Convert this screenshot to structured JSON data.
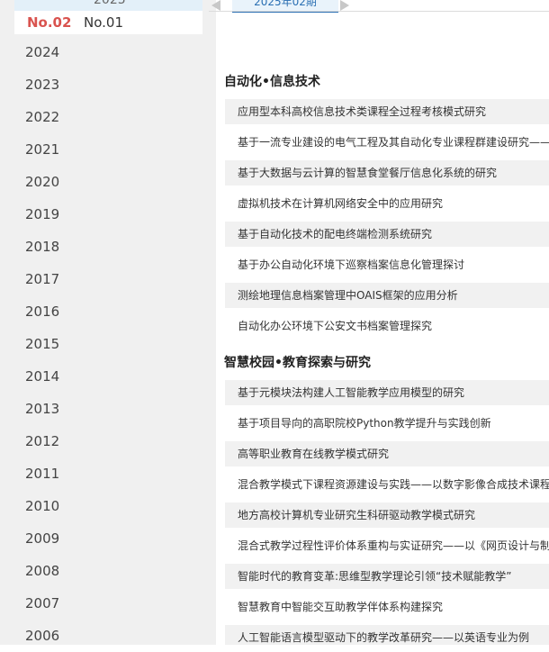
{
  "sidebar": {
    "top_year": "2025",
    "current_issue": "No.02",
    "other_issue": "No.01",
    "years": [
      "2024",
      "2023",
      "2022",
      "2021",
      "2020",
      "2019",
      "2018",
      "2017",
      "2016",
      "2015",
      "2014",
      "2013",
      "2012",
      "2011",
      "2010",
      "2009",
      "2008",
      "2007",
      "2006"
    ]
  },
  "tabbar": {
    "active_tab": "2025年02期"
  },
  "sections": [
    {
      "title": "自动化•信息技术",
      "articles": [
        "应用型本科高校信息技术类课程全过程考核模式研究",
        "基于一流专业建设的电气工程及其自动化专业课程群建设研究——",
        "基于大数据与云计算的智慧食堂餐厅信息化系统的研究",
        "虚拟机技术在计算机网络安全中的应用研究",
        "基于自动化技术的配电终端检测系统研究",
        "基于办公自动化环境下巡察档案信息化管理探讨",
        "测绘地理信息档案管理中OAIS框架的应用分析",
        "自动化办公环境下公安文书档案管理探究"
      ]
    },
    {
      "title": "智慧校园•教育探索与研究",
      "articles": [
        "基于元模块法构建人工智能教学应用模型的研究",
        "基于项目导向的高职院校Python教学提升与实践创新",
        "高等职业教育在线教学模式研究",
        "混合教学模式下课程资源建设与实践——以数字影像合成技术课程",
        "地方高校计算机专业研究生科研驱动教学模式研究",
        "混合式教学过程性评价体系重构与实证研究——以《网页设计与制",
        "智能时代的教育变革:思维型教学理论引领“技术赋能教学”",
        "智慧教育中智能交互助教学伴体系构建探究",
        "人工智能语言模型驱动下的教学改革研究——以英语专业为例"
      ]
    }
  ]
}
